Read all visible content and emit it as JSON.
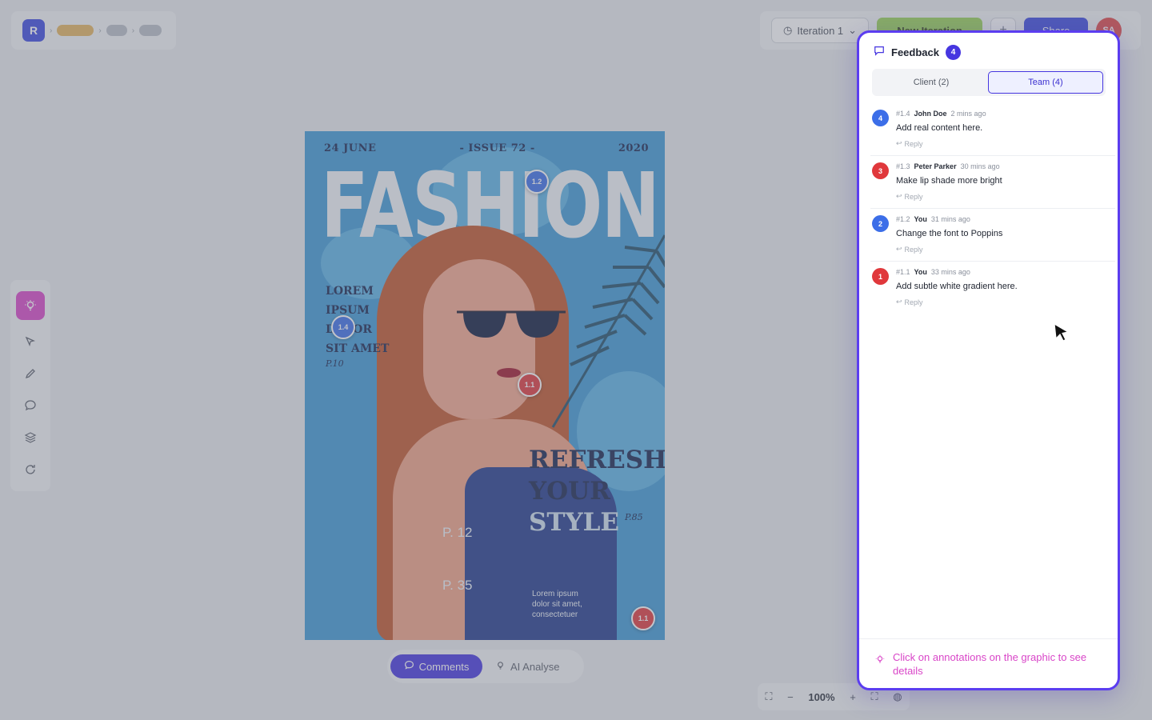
{
  "app": {
    "logo_letter": "R",
    "iteration_label": "Iteration 1",
    "new_iteration_label": "New Iteration",
    "share_label": "Share",
    "avatar_initials": "SA"
  },
  "toolbar": {
    "tools": [
      "ai-bulb-icon",
      "select-arrow-icon",
      "pen-icon",
      "comment-icon",
      "layers-icon",
      "refresh-icon"
    ]
  },
  "poster": {
    "date": "24 JUNE",
    "issue": "- ISSUE 72 -",
    "year": "2020",
    "title": "FASHION",
    "side_copy": [
      "LOREM",
      "IPSUM",
      "DOLOR",
      "SIT AMET"
    ],
    "side_page": "P.10",
    "headline": [
      "REFRESH",
      "YOUR",
      "STYLE"
    ],
    "headline_page": "P.85",
    "page_a": "P. 12",
    "page_b": "P. 35",
    "lorem_lines": [
      "Lorem ipsum",
      "dolor sit amet,",
      "consectetuer"
    ]
  },
  "annotations": [
    {
      "label": "1.2",
      "color": "blue"
    },
    {
      "label": "1.4",
      "color": "blue"
    },
    {
      "label": "1.1",
      "color": "red"
    },
    {
      "label": "1.1",
      "color": "red"
    }
  ],
  "bottom_bar": {
    "comments_label": "Comments",
    "analyse_label": "AI Analyse"
  },
  "zoom": {
    "level": "100%"
  },
  "feedback": {
    "title": "Feedback",
    "count": "4",
    "tabs": [
      {
        "label": "Client (2)",
        "active": false
      },
      {
        "label": "Team (4)",
        "active": true
      }
    ],
    "comments": [
      {
        "badge": "4",
        "color": "blue",
        "id": "#1.4",
        "author": "John Doe",
        "time": "2 mins ago",
        "text": "Add real content here.",
        "reply": "Reply"
      },
      {
        "badge": "3",
        "color": "red",
        "id": "#1.3",
        "author": "Peter Parker",
        "time": "30 mins ago",
        "text": "Make lip shade more bright",
        "reply": "Reply"
      },
      {
        "badge": "2",
        "color": "blue",
        "id": "#1.2",
        "author": "You",
        "time": "31 mins ago",
        "text": "Change the font to Poppins",
        "reply": "Reply"
      },
      {
        "badge": "1",
        "color": "red",
        "id": "#1.1",
        "author": "You",
        "time": "33 mins ago",
        "text": "Add subtle white gradient here.",
        "reply": "Reply"
      }
    ],
    "hint": "Click on annotations on the graphic to see details"
  },
  "colors": {
    "accent": "#4636e0",
    "panel_border": "#5b3df0",
    "hint": "#d946c8",
    "annotation_blue": "#3c6ee8",
    "annotation_red": "#e0383c"
  }
}
